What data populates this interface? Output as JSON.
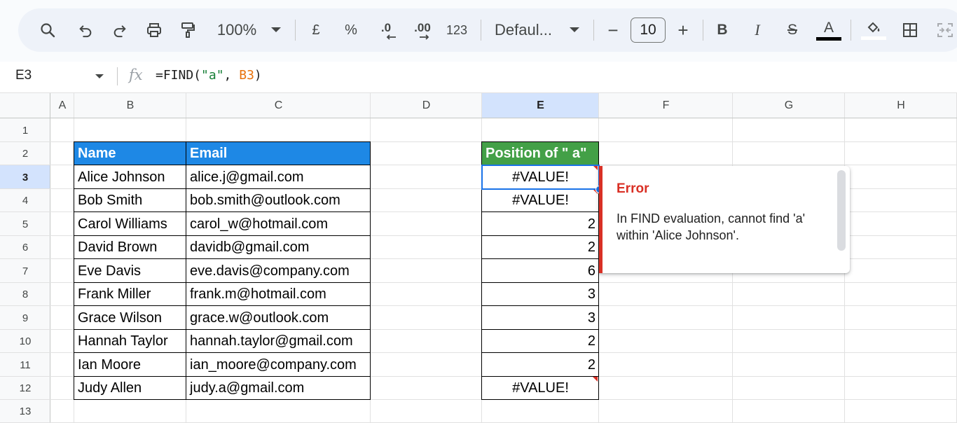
{
  "toolbar": {
    "zoom": "100%",
    "currency": "£",
    "percent": "%",
    "dec_decrease": ".0",
    "dec_increase": ".00",
    "number_format": "123",
    "font": "Defaul...",
    "font_size": "10",
    "minus": "−",
    "plus": "+",
    "bold": "B",
    "italic": "I",
    "strike": "S",
    "text_color_glyph": "A"
  },
  "formula_bar": {
    "cell_ref": "E3",
    "fx": "fx",
    "formula_prefix": "=FIND(",
    "formula_str": "\"a\"",
    "formula_sep": ", ",
    "formula_ref": "B3",
    "formula_suffix": ")"
  },
  "columns": [
    "A",
    "B",
    "C",
    "D",
    "E",
    "F",
    "G",
    "H"
  ],
  "rows": [
    "1",
    "2",
    "3",
    "4",
    "5",
    "6",
    "7",
    "8",
    "9",
    "10",
    "11",
    "12",
    "13"
  ],
  "selected_cell": {
    "column": "E",
    "row": "3"
  },
  "table": {
    "header_name": "Name",
    "header_email": "Email",
    "header_position": "Position of \" a\"",
    "name_header_color": "#1e88e5",
    "position_header_color": "#43a047",
    "records": [
      {
        "name": "Alice Johnson",
        "email": "alice.j@gmail.com",
        "position": "#VALUE!"
      },
      {
        "name": "Bob Smith",
        "email": "bob.smith@outlook.com",
        "position": "#VALUE!"
      },
      {
        "name": "Carol Williams",
        "email": "carol_w@hotmail.com",
        "position": "2"
      },
      {
        "name": "David Brown",
        "email": "davidb@gmail.com",
        "position": "2"
      },
      {
        "name": "Eve Davis",
        "email": "eve.davis@company.com",
        "position": "6"
      },
      {
        "name": "Frank Miller",
        "email": "frank.m@hotmail.com",
        "position": "3"
      },
      {
        "name": "Grace Wilson",
        "email": "grace.w@outlook.com",
        "position": "3"
      },
      {
        "name": "Hannah Taylor",
        "email": "hannah.taylor@gmail.com",
        "position": "2"
      },
      {
        "name": "Ian Moore",
        "email": "ian_moore@company.com",
        "position": "2"
      },
      {
        "name": "Judy Allen",
        "email": "judy.a@gmail.com",
        "position": "#VALUE!"
      }
    ]
  },
  "error_popup": {
    "title": "Error",
    "message": "In FIND evaluation, cannot find 'a' within 'Alice Johnson'.",
    "accent_color": "#d93025"
  },
  "icons": [
    "search-icon",
    "undo-icon",
    "redo-icon",
    "print-icon",
    "paint-format-icon",
    "zoom-dropdown-icon",
    "font-dropdown-icon",
    "text-color-icon",
    "fill-color-icon",
    "borders-icon",
    "merge-cells-icon",
    "name-box-dropdown-icon"
  ]
}
